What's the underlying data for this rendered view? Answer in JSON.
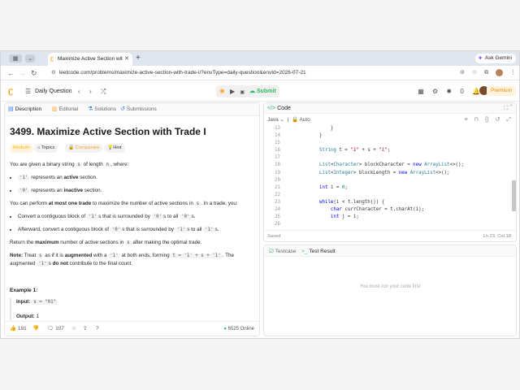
{
  "browser": {
    "tab_title": "Maximize Active Section wit",
    "new_tab": "+",
    "ask_gemini": "Ask Gemini",
    "url": "leetcode.com/problems/maximize-active-section-with-trade-i/?envType=daily-question&envId=2026-07-21"
  },
  "toolbar": {
    "daily_label": "Daily Question",
    "submit_label": "Submit",
    "count": "0",
    "premium_label": "Premium"
  },
  "left_tabs": {
    "description": "Description",
    "editorial": "Editorial",
    "solutions": "Solutions",
    "submissions": "Submissions"
  },
  "problem": {
    "title": "3499. Maximize Active Section with Trade I",
    "badges": {
      "difficulty": "Medium",
      "topics": "Topics",
      "companies": "Companies",
      "hint": "Hint"
    },
    "intro_pre": "You are given a binary string ",
    "intro_code": "s",
    "intro_post": " of length ",
    "intro_code2": "n",
    "intro_end": ", where:",
    "b1_code": "'1'",
    "b1_pre": " represents an ",
    "b1_bold": "active",
    "b1_post": " section.",
    "b2_code": "'0'",
    "b2_pre": " represents an ",
    "b2_bold": "inactive",
    "b2_post": " section.",
    "p2_pre": "You can perform ",
    "p2_bold": "at most one trade",
    "p2_mid": " to maximize the number of active sections in ",
    "p2_code": "s",
    "p2_post": ". In a trade, you:",
    "t1_pre": "Convert a contiguous block of ",
    "t1_c1": "'1'",
    "t1_mid": "s that is surrounded by ",
    "t1_c2": "'0'",
    "t1_mid2": "s to all ",
    "t1_c3": "'0'",
    "t1_post": "s.",
    "t2_pre": "Afterward, convert a contiguous block of ",
    "t2_c1": "'0'",
    "t2_mid": "s that is surrounded by ",
    "t2_c2": "'1'",
    "t2_mid2": "s to all ",
    "t2_c3": "'1'",
    "t2_post": "s.",
    "p3_pre": "Return the ",
    "p3_bold": "maximum",
    "p3_mid": " number of active sections in ",
    "p3_code": "s",
    "p3_post": " after making the optimal trade.",
    "note_bold": "Note:",
    "note_pre": " Treat ",
    "note_c1": "s",
    "note_mid": " as if it is ",
    "note_bold2": "augmented",
    "note_mid2": " with a ",
    "note_c2": "'1'",
    "note_mid3": " at both ends, forming ",
    "note_c3": "t = '1' + s + '1'",
    "note_end": ". The",
    "note2_pre": "augmented ",
    "note2_c": "'1'",
    "note2_mid": "s ",
    "note2_bold": "do not",
    "note2_post": " contribute to the final count.",
    "example_title": "Example 1:",
    "input_label": "Input: ",
    "input_value": "s = \"01\"",
    "output_label": "Output: ",
    "output_value": "1"
  },
  "left_footer": {
    "likes": "191",
    "comments": "107",
    "online": "6525 Online"
  },
  "code_panel": {
    "title": "Code",
    "language": "Java",
    "auto": "Auto",
    "status": "Saved",
    "cursor": "Ln 23, Col 18",
    "lines": [
      {
        "n": "13",
        "t": "        }"
      },
      {
        "n": "14",
        "t": "    }"
      },
      {
        "n": "15",
        "t": ""
      },
      {
        "n": "16",
        "t": "    String t = \"1\" + s + \"1\";"
      },
      {
        "n": "17",
        "t": ""
      },
      {
        "n": "18",
        "t": "    List<Character> blockCharacter = new ArrayList<>();"
      },
      {
        "n": "19",
        "t": "    List<Integer> blockLength = new ArrayList<>();"
      },
      {
        "n": "20",
        "t": ""
      },
      {
        "n": "21",
        "t": "    int i = 0;"
      },
      {
        "n": "22",
        "t": ""
      },
      {
        "n": "23",
        "t": "    while(i < t.length()) {"
      },
      {
        "n": "24",
        "t": "        char currCharacter = t.charAt(i);"
      },
      {
        "n": "25",
        "t": "        int j = i;"
      },
      {
        "n": "26",
        "t": ""
      }
    ]
  },
  "test_panel": {
    "testcase": "Testcase",
    "result": "Test Result",
    "message": "You must run your code first"
  }
}
